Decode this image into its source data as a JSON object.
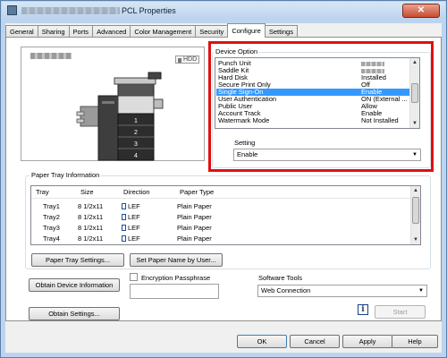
{
  "window": {
    "title": "PCL Properties",
    "close_glyph": "✕"
  },
  "tabs": [
    "General",
    "Sharing",
    "Ports",
    "Advanced",
    "Color Management",
    "Security",
    "Configure",
    "Settings"
  ],
  "active_tab": "Configure",
  "preview": {
    "hdd_label": "HDD"
  },
  "device_option": {
    "title": "Device Option",
    "items": [
      {
        "name": "Punch Unit",
        "value": ""
      },
      {
        "name": "Saddle Kit",
        "value": ""
      },
      {
        "name": "Hard Disk",
        "value": "Installed"
      },
      {
        "name": "Secure Print Only",
        "value": "Off"
      },
      {
        "name": "Single Sign-On",
        "value": "Enable",
        "selected": true
      },
      {
        "name": "User Authentication",
        "value": "ON (External ..."
      },
      {
        "name": "Public User",
        "value": "Allow"
      },
      {
        "name": "Account Track",
        "value": "Enable"
      },
      {
        "name": "Watermark Mode",
        "value": "Not Installed"
      }
    ],
    "setting_label": "Setting",
    "setting_value": "Enable"
  },
  "paper_tray": {
    "title": "Paper Tray Information",
    "columns": [
      "Tray",
      "Size",
      "Direction",
      "Paper Type"
    ],
    "rows": [
      {
        "tray": "Tray1",
        "size": "8 1/2x11",
        "direction": "LEF",
        "paper_type": "Plain Paper"
      },
      {
        "tray": "Tray2",
        "size": "8 1/2x11",
        "direction": "LEF",
        "paper_type": "Plain Paper"
      },
      {
        "tray": "Tray3",
        "size": "8 1/2x11",
        "direction": "LEF",
        "paper_type": "Plain Paper"
      },
      {
        "tray": "Tray4",
        "size": "8 1/2x11",
        "direction": "LEF",
        "paper_type": "Plain Paper"
      }
    ]
  },
  "buttons": {
    "paper_tray_settings": "Paper Tray Settings...",
    "set_paper_name": "Set Paper Name by User...",
    "obtain_device_info": "Obtain Device Information",
    "obtain_settings": "Obtain Settings...",
    "start": "Start",
    "ok": "OK",
    "cancel": "Cancel",
    "apply": "Apply",
    "help": "Help"
  },
  "encryption": {
    "label": "Encryption Passphrase",
    "checked": false
  },
  "software_tools": {
    "label": "Software Tools",
    "value": "Web Connection"
  },
  "info_glyph": "i",
  "scroll_glyphs": {
    "up": "▲",
    "down": "▼"
  }
}
